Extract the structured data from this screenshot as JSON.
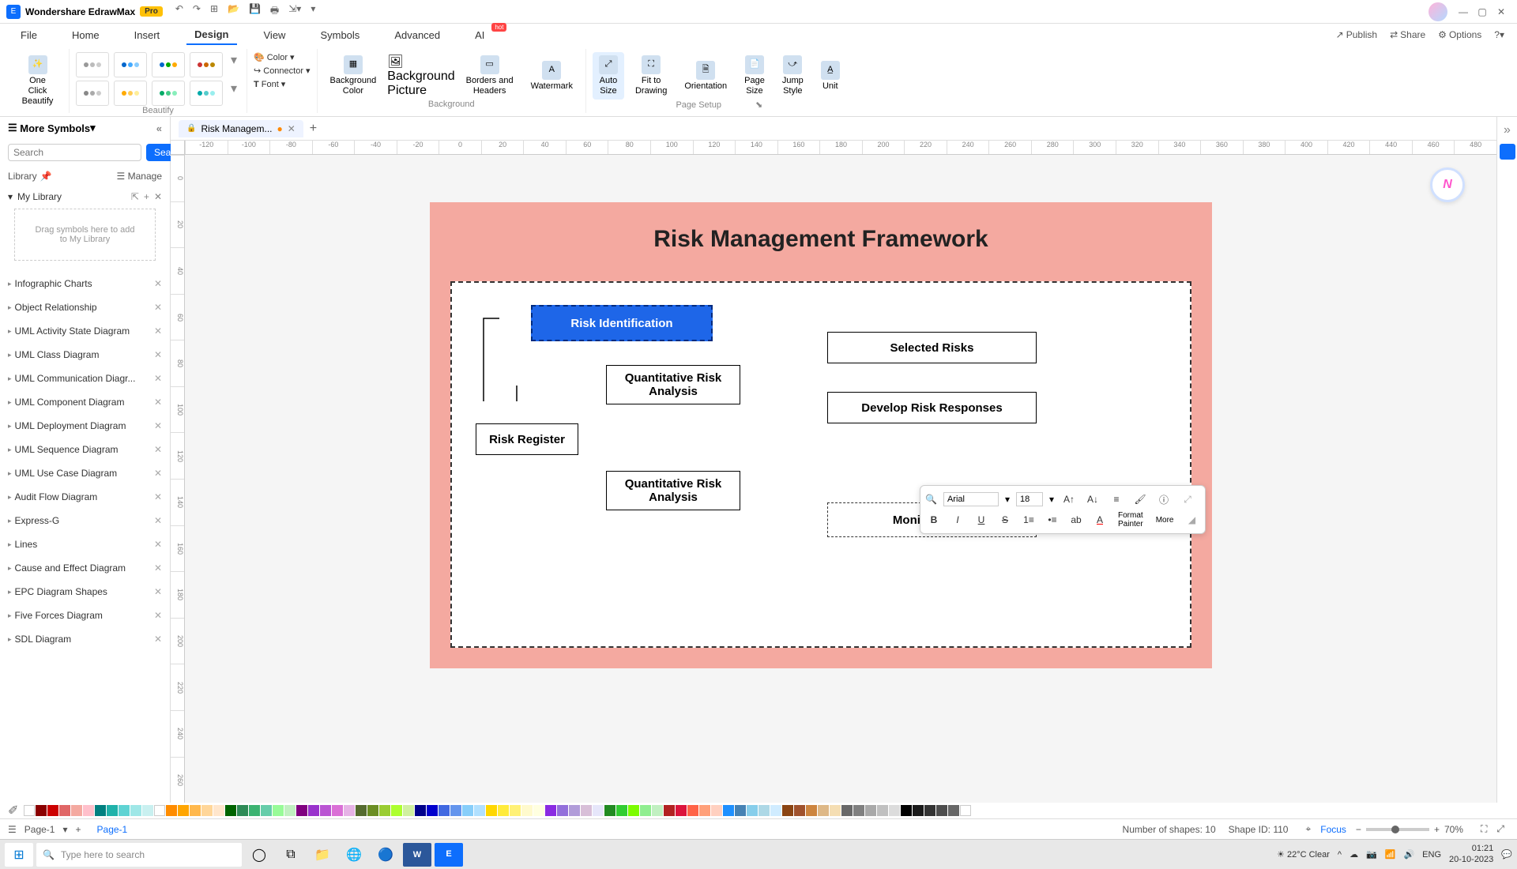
{
  "app": {
    "name": "Wondershare EdrawMax",
    "badge": "Pro"
  },
  "menus": {
    "file": "File",
    "home": "Home",
    "insert": "Insert",
    "design": "Design",
    "view": "View",
    "symbols": "Symbols",
    "advanced": "Advanced",
    "ai": "AI",
    "hot": "hot"
  },
  "topright": {
    "publish": "Publish",
    "share": "Share",
    "options": "Options"
  },
  "ribbon": {
    "oneclick": "One Click\nBeautify",
    "beautify_label": "Beautify",
    "color": "Color",
    "connector": "Connector",
    "font": "Font",
    "bgcolor": "Background\nColor",
    "bgpic": "Background\nPicture",
    "borders": "Borders and\nHeaders",
    "watermark": "Watermark",
    "bg_label": "Background",
    "autosize": "Auto\nSize",
    "fit": "Fit to\nDrawing",
    "orient": "Orientation",
    "pagesize": "Page\nSize",
    "jump": "Jump\nStyle",
    "unit": "Unit",
    "pagesetup_label": "Page Setup"
  },
  "sidebar": {
    "title": "More Symbols",
    "search_ph": "Search",
    "search_btn": "Search",
    "library": "Library",
    "manage": "Manage",
    "mylib": "My Library",
    "mylib_hint": "Drag symbols here to add to My Library",
    "items": [
      "Infographic Charts",
      "Object Relationship",
      "UML Activity State Diagram",
      "UML Class Diagram",
      "UML Communication Diagr...",
      "UML Component Diagram",
      "UML Deployment Diagram",
      "UML Sequence Diagram",
      "UML Use Case Diagram",
      "Audit Flow Diagram",
      "Express-G",
      "Lines",
      "Cause and Effect Diagram",
      "EPC Diagram Shapes",
      "Five Forces Diagram",
      "SDL Diagram"
    ]
  },
  "tab": {
    "name": "Risk Managem...",
    "page1": "Page-1",
    "pagesel": "Page-1"
  },
  "diagram": {
    "title": "Risk Management Framework",
    "risk_id": "Risk Identification",
    "qra1": "Quantitative Risk\nAnalysis",
    "qra2": "Quantitative Risk\nAnalysis",
    "reg": "Risk Register",
    "sel": "Selected Risks",
    "dev": "Develop Risk Responses",
    "mon": "Monitor Risks"
  },
  "float": {
    "font": "Arial",
    "size": "18",
    "fp": "Format\nPainter",
    "more": "More"
  },
  "ruler_h": [
    "-120",
    "-100",
    "-80",
    "-60",
    "-40",
    "-20",
    "0",
    "20",
    "40",
    "60",
    "80",
    "100",
    "120",
    "140",
    "160",
    "180",
    "200",
    "220",
    "240",
    "260",
    "280",
    "300",
    "320",
    "340",
    "360",
    "380",
    "400",
    "420",
    "440",
    "460",
    "480"
  ],
  "ruler_v": [
    "0",
    "20",
    "40",
    "60",
    "80",
    "100",
    "120",
    "140",
    "160",
    "180",
    "200",
    "220",
    "240",
    "260"
  ],
  "status": {
    "shapes": "Number of shapes: 10",
    "shapeid": "Shape ID: 110",
    "focus": "Focus",
    "zoom": "70%"
  },
  "taskbar": {
    "search": "Type here to search",
    "weather": "22°C  Clear",
    "lang": "ENG",
    "time": "01:21",
    "date": "20-10-2023"
  },
  "ai_badge": "N",
  "colors": [
    "#ffffff",
    "#8b0000",
    "#c00",
    "#e06666",
    "#f4a9a0",
    "#ffc0cb",
    "#008080",
    "#20b2aa",
    "#5fd3d3",
    "#9fe7e7",
    "#c9f0f0",
    "#ffffff",
    "#ff8c00",
    "#ffa500",
    "#ffb84d",
    "#ffd699",
    "#ffe6cc",
    "#006400",
    "#2e8b57",
    "#3cb371",
    "#66cdaa",
    "#98fb98",
    "#c1f0c1",
    "#800080",
    "#9932cc",
    "#ba55d3",
    "#da70d6",
    "#e6b3e6",
    "#556b2f",
    "#6b8e23",
    "#9acd32",
    "#adff2f",
    "#d0f0a0",
    "#00008b",
    "#0000cd",
    "#4169e1",
    "#6495ed",
    "#87cefa",
    "#b0e0ff",
    "#ffd700",
    "#ffeb3b",
    "#fff176",
    "#fffacd",
    "#ffffe0",
    "#8a2be2",
    "#9370db",
    "#b19cd9",
    "#d8bfd8",
    "#e6e6fa",
    "#228b22",
    "#32cd32",
    "#7cfc00",
    "#90ee90",
    "#c1f0c1",
    "#b22222",
    "#dc143c",
    "#ff6347",
    "#ffa07a",
    "#ffd0c0",
    "#1e90ff",
    "#4682b4",
    "#87ceeb",
    "#add8e6",
    "#d0ecff",
    "#8b4513",
    "#a0522d",
    "#cd853f",
    "#deb887",
    "#f5deb3",
    "#696969",
    "#808080",
    "#a9a9a9",
    "#c0c0c0",
    "#dcdcdc",
    "#000000",
    "#1a1a1a",
    "#333333",
    "#4d4d4d",
    "#666666",
    "#ffffff"
  ]
}
